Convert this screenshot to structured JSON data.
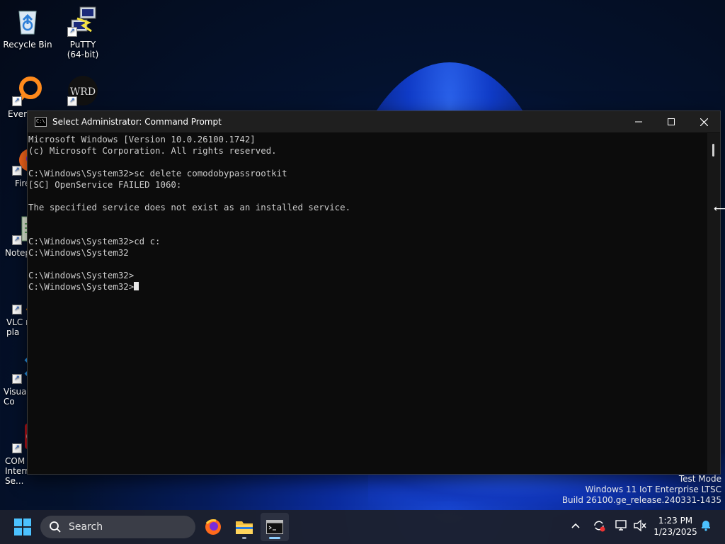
{
  "desktop": {
    "icons": [
      {
        "label": "Recycle Bin",
        "icon": "recycle-bin-icon"
      },
      {
        "label": "PuTTY\n(64-bit)",
        "icon": "putty-icon"
      },
      {
        "label": "Every",
        "icon": "everything-icon"
      },
      {
        "label": "Fire",
        "icon": "firefox-icon"
      },
      {
        "label": "Notep",
        "icon": "notepad-icon"
      },
      {
        "label": "VLC m\npla",
        "icon": "vlc-icon"
      },
      {
        "label": "Visual\nCo",
        "icon": "vscode-icon"
      },
      {
        "label": "COM\nInternet Se...",
        "icon": "comodo-icon"
      }
    ]
  },
  "window": {
    "title": "Select Administrator: Command Prompt",
    "app_icon_text": "C:\\",
    "buttons": {
      "minimize": "minimize-icon",
      "maximize": "maximize-icon",
      "close": "close-icon"
    },
    "console_lines": [
      "Microsoft Windows [Version 10.0.26100.1742]",
      "(c) Microsoft Corporation. All rights reserved.",
      "",
      "C:\\Windows\\System32>sc delete comodobypassrootkit",
      "[SC] OpenService FAILED 1060:",
      "",
      "The specified service does not exist as an installed service.",
      "",
      "",
      "C:\\Windows\\System32>cd c:",
      "C:\\Windows\\System32",
      "",
      "C:\\Windows\\System32>"
    ],
    "prompt": "C:\\Windows\\System32>"
  },
  "watermark": {
    "line1": "Test Mode",
    "line2": "Windows 11 IoT Enterprise LTSC",
    "line3": "Build 26100.ge_release.240331-1435"
  },
  "taskbar": {
    "search_placeholder": "Search",
    "pinned": [
      "firefox-icon",
      "file-explorer-icon",
      "terminal-icon"
    ],
    "tray": [
      "chevron-up-icon",
      "update-icon",
      "network-icon",
      "volume-muted-icon"
    ],
    "time": "1:23 PM",
    "date": "1/23/2025",
    "notification": "bell-icon"
  },
  "colors": {
    "console_bg": "#0c0c0c",
    "console_text": "#cccccc",
    "titlebar": "#1f1f1f",
    "taskbar": "#1c202e",
    "accent": "#4cc2ff"
  }
}
